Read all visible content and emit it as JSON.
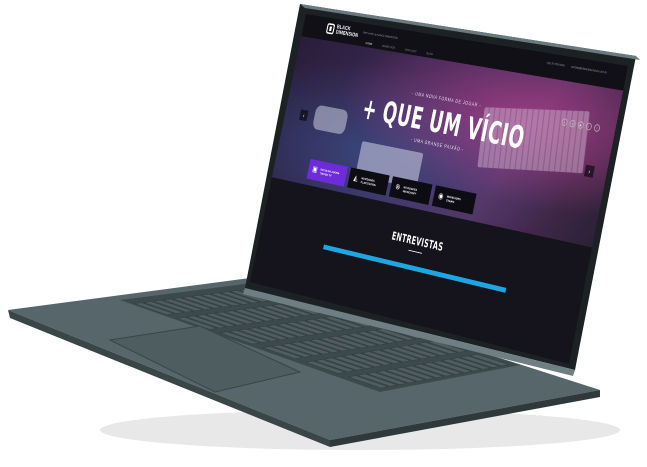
{
  "site": {
    "logo_text": "BLACK DIMENSION",
    "tagline": "Bem-vindo ao BLACK DIMENSION",
    "nav": [
      "HOME",
      "SOBRE NÓS",
      "SERVIÇOS",
      "BLOG"
    ],
    "contact": [
      "(11) 97070-0000",
      "contato@blackdimension.com.br"
    ],
    "social_icons": [
      "search-icon",
      "instagram-icon",
      "youtube-icon",
      "facebook-icon",
      "twitter-icon"
    ]
  },
  "hero": {
    "eyebrow": "- UMA NOVA FORMA DE JOGAR -",
    "title": "+ QUE UM VÍCIO",
    "subtitle": "- UMA GRANDE PAIXÃO -",
    "prev_arrow": "‹",
    "next_arrow": "›"
  },
  "cta_buttons": [
    {
      "label": "ESCOLHA AGORA\nTWITCH TV",
      "icon": "twitch-icon"
    },
    {
      "label": "NOVIDADES\nPLAYSTATION",
      "icon": "playstation-icon"
    },
    {
      "label": "NOVIDADES\nMICROSOFT",
      "icon": "xbox-icon"
    },
    {
      "label": "NOVIDADES\nSTEAM",
      "icon": "steam-icon"
    }
  ],
  "section": {
    "title": "ENTREVISTAS"
  },
  "colors": {
    "accent": "#6d2bd9",
    "bar": "#1fa6e0",
    "laptop": "#4c575b"
  }
}
